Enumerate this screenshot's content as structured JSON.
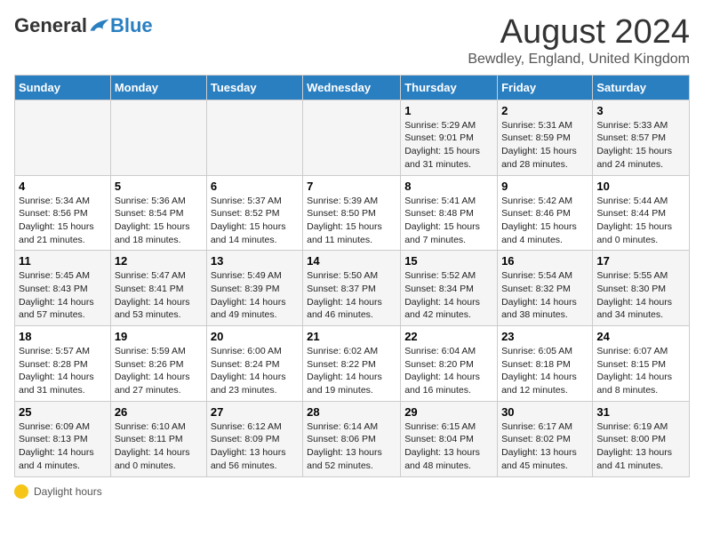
{
  "logo": {
    "general": "General",
    "blue": "Blue"
  },
  "header": {
    "month": "August 2024",
    "location": "Bewdley, England, United Kingdom"
  },
  "weekdays": [
    "Sunday",
    "Monday",
    "Tuesday",
    "Wednesday",
    "Thursday",
    "Friday",
    "Saturday"
  ],
  "weeks": [
    [
      {
        "day": "",
        "sunrise": "",
        "sunset": "",
        "daylight": ""
      },
      {
        "day": "",
        "sunrise": "",
        "sunset": "",
        "daylight": ""
      },
      {
        "day": "",
        "sunrise": "",
        "sunset": "",
        "daylight": ""
      },
      {
        "day": "",
        "sunrise": "",
        "sunset": "",
        "daylight": ""
      },
      {
        "day": "1",
        "sunrise": "Sunrise: 5:29 AM",
        "sunset": "Sunset: 9:01 PM",
        "daylight": "Daylight: 15 hours and 31 minutes."
      },
      {
        "day": "2",
        "sunrise": "Sunrise: 5:31 AM",
        "sunset": "Sunset: 8:59 PM",
        "daylight": "Daylight: 15 hours and 28 minutes."
      },
      {
        "day": "3",
        "sunrise": "Sunrise: 5:33 AM",
        "sunset": "Sunset: 8:57 PM",
        "daylight": "Daylight: 15 hours and 24 minutes."
      }
    ],
    [
      {
        "day": "4",
        "sunrise": "Sunrise: 5:34 AM",
        "sunset": "Sunset: 8:56 PM",
        "daylight": "Daylight: 15 hours and 21 minutes."
      },
      {
        "day": "5",
        "sunrise": "Sunrise: 5:36 AM",
        "sunset": "Sunset: 8:54 PM",
        "daylight": "Daylight: 15 hours and 18 minutes."
      },
      {
        "day": "6",
        "sunrise": "Sunrise: 5:37 AM",
        "sunset": "Sunset: 8:52 PM",
        "daylight": "Daylight: 15 hours and 14 minutes."
      },
      {
        "day": "7",
        "sunrise": "Sunrise: 5:39 AM",
        "sunset": "Sunset: 8:50 PM",
        "daylight": "Daylight: 15 hours and 11 minutes."
      },
      {
        "day": "8",
        "sunrise": "Sunrise: 5:41 AM",
        "sunset": "Sunset: 8:48 PM",
        "daylight": "Daylight: 15 hours and 7 minutes."
      },
      {
        "day": "9",
        "sunrise": "Sunrise: 5:42 AM",
        "sunset": "Sunset: 8:46 PM",
        "daylight": "Daylight: 15 hours and 4 minutes."
      },
      {
        "day": "10",
        "sunrise": "Sunrise: 5:44 AM",
        "sunset": "Sunset: 8:44 PM",
        "daylight": "Daylight: 15 hours and 0 minutes."
      }
    ],
    [
      {
        "day": "11",
        "sunrise": "Sunrise: 5:45 AM",
        "sunset": "Sunset: 8:43 PM",
        "daylight": "Daylight: 14 hours and 57 minutes."
      },
      {
        "day": "12",
        "sunrise": "Sunrise: 5:47 AM",
        "sunset": "Sunset: 8:41 PM",
        "daylight": "Daylight: 14 hours and 53 minutes."
      },
      {
        "day": "13",
        "sunrise": "Sunrise: 5:49 AM",
        "sunset": "Sunset: 8:39 PM",
        "daylight": "Daylight: 14 hours and 49 minutes."
      },
      {
        "day": "14",
        "sunrise": "Sunrise: 5:50 AM",
        "sunset": "Sunset: 8:37 PM",
        "daylight": "Daylight: 14 hours and 46 minutes."
      },
      {
        "day": "15",
        "sunrise": "Sunrise: 5:52 AM",
        "sunset": "Sunset: 8:34 PM",
        "daylight": "Daylight: 14 hours and 42 minutes."
      },
      {
        "day": "16",
        "sunrise": "Sunrise: 5:54 AM",
        "sunset": "Sunset: 8:32 PM",
        "daylight": "Daylight: 14 hours and 38 minutes."
      },
      {
        "day": "17",
        "sunrise": "Sunrise: 5:55 AM",
        "sunset": "Sunset: 8:30 PM",
        "daylight": "Daylight: 14 hours and 34 minutes."
      }
    ],
    [
      {
        "day": "18",
        "sunrise": "Sunrise: 5:57 AM",
        "sunset": "Sunset: 8:28 PM",
        "daylight": "Daylight: 14 hours and 31 minutes."
      },
      {
        "day": "19",
        "sunrise": "Sunrise: 5:59 AM",
        "sunset": "Sunset: 8:26 PM",
        "daylight": "Daylight: 14 hours and 27 minutes."
      },
      {
        "day": "20",
        "sunrise": "Sunrise: 6:00 AM",
        "sunset": "Sunset: 8:24 PM",
        "daylight": "Daylight: 14 hours and 23 minutes."
      },
      {
        "day": "21",
        "sunrise": "Sunrise: 6:02 AM",
        "sunset": "Sunset: 8:22 PM",
        "daylight": "Daylight: 14 hours and 19 minutes."
      },
      {
        "day": "22",
        "sunrise": "Sunrise: 6:04 AM",
        "sunset": "Sunset: 8:20 PM",
        "daylight": "Daylight: 14 hours and 16 minutes."
      },
      {
        "day": "23",
        "sunrise": "Sunrise: 6:05 AM",
        "sunset": "Sunset: 8:18 PM",
        "daylight": "Daylight: 14 hours and 12 minutes."
      },
      {
        "day": "24",
        "sunrise": "Sunrise: 6:07 AM",
        "sunset": "Sunset: 8:15 PM",
        "daylight": "Daylight: 14 hours and 8 minutes."
      }
    ],
    [
      {
        "day": "25",
        "sunrise": "Sunrise: 6:09 AM",
        "sunset": "Sunset: 8:13 PM",
        "daylight": "Daylight: 14 hours and 4 minutes."
      },
      {
        "day": "26",
        "sunrise": "Sunrise: 6:10 AM",
        "sunset": "Sunset: 8:11 PM",
        "daylight": "Daylight: 14 hours and 0 minutes."
      },
      {
        "day": "27",
        "sunrise": "Sunrise: 6:12 AM",
        "sunset": "Sunset: 8:09 PM",
        "daylight": "Daylight: 13 hours and 56 minutes."
      },
      {
        "day": "28",
        "sunrise": "Sunrise: 6:14 AM",
        "sunset": "Sunset: 8:06 PM",
        "daylight": "Daylight: 13 hours and 52 minutes."
      },
      {
        "day": "29",
        "sunrise": "Sunrise: 6:15 AM",
        "sunset": "Sunset: 8:04 PM",
        "daylight": "Daylight: 13 hours and 48 minutes."
      },
      {
        "day": "30",
        "sunrise": "Sunrise: 6:17 AM",
        "sunset": "Sunset: 8:02 PM",
        "daylight": "Daylight: 13 hours and 45 minutes."
      },
      {
        "day": "31",
        "sunrise": "Sunrise: 6:19 AM",
        "sunset": "Sunset: 8:00 PM",
        "daylight": "Daylight: 13 hours and 41 minutes."
      }
    ]
  ],
  "footer": {
    "daylight_label": "Daylight hours"
  }
}
